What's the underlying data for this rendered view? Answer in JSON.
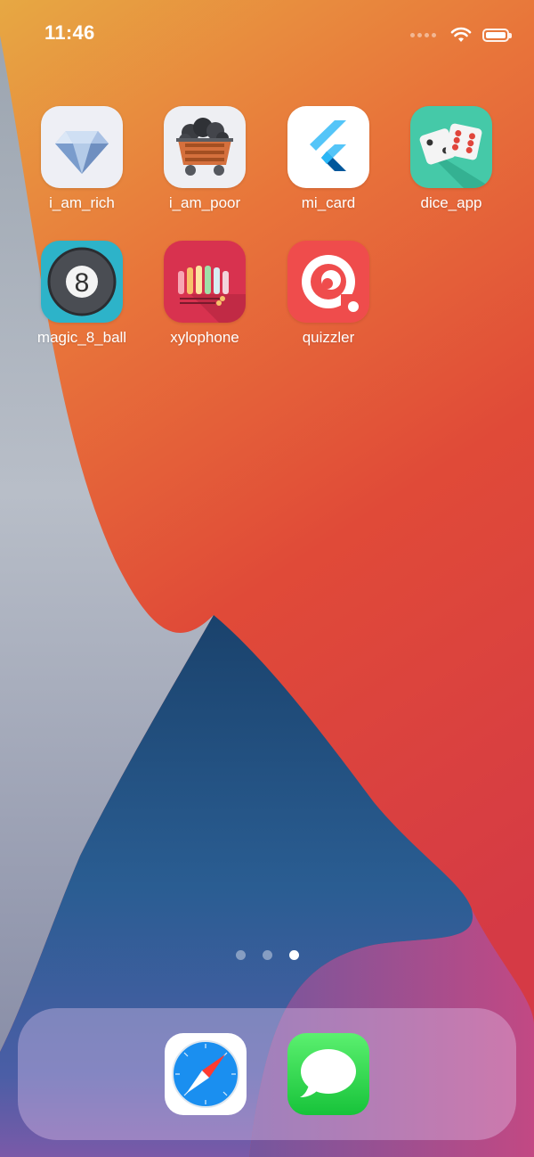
{
  "status_bar": {
    "time": "11:46",
    "battery_level": 1.0
  },
  "home_screen": {
    "apps": [
      {
        "label": "i_am_rich",
        "icon": "diamond-icon"
      },
      {
        "label": "i_am_poor",
        "icon": "coal-cart-icon"
      },
      {
        "label": "mi_card",
        "icon": "flutter-logo-icon"
      },
      {
        "label": "dice_app",
        "icon": "dice-icon"
      },
      {
        "label": "magic_8_ball",
        "icon": "eight-ball-icon"
      },
      {
        "label": "xylophone",
        "icon": "xylophone-icon"
      },
      {
        "label": "quizzler",
        "icon": "quizzler-icon"
      }
    ],
    "page_count": 3,
    "current_page": 3
  },
  "dock": {
    "apps": [
      {
        "name": "Safari",
        "icon": "safari-compass-icon"
      },
      {
        "name": "Messages",
        "icon": "messages-bubble-icon"
      }
    ]
  },
  "colors": {
    "wallpaper_orange": "#e88a3e",
    "wallpaper_red": "#dc3c3a",
    "wallpaper_blue": "#1e4e7c",
    "wallpaper_gray": "#aab4c2"
  }
}
